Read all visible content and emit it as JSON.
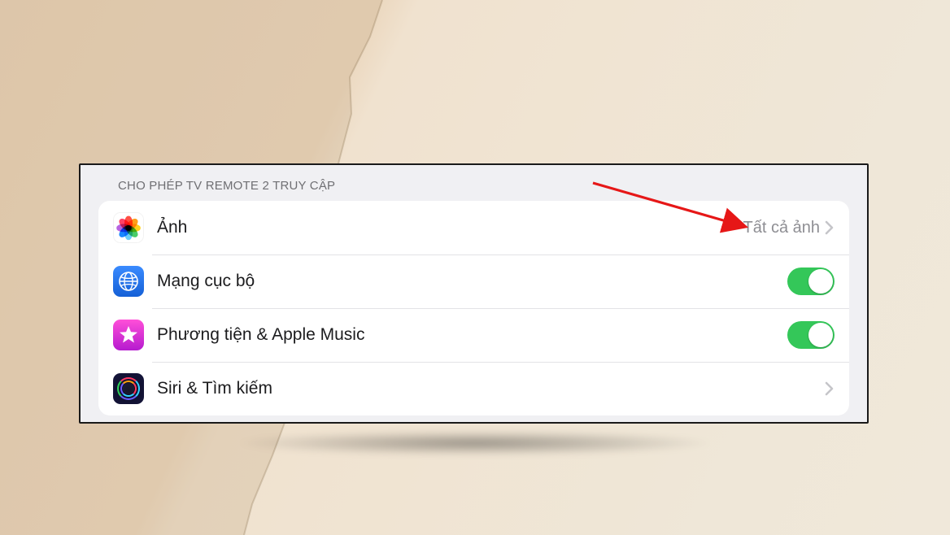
{
  "section_header": "CHO PHÉP TV REMOTE 2 TRUY CẬP",
  "rows": {
    "photos": {
      "label": "Ảnh",
      "value": "Tất cả ảnh"
    },
    "network": {
      "label": "Mạng cục bộ",
      "toggle": true
    },
    "media": {
      "label": "Phương tiện & Apple Music",
      "toggle": true
    },
    "siri": {
      "label": "Siri & Tìm kiếm"
    }
  },
  "annotation": {
    "arrow_color": "#e61717"
  },
  "icons": {
    "photos_petals": [
      {
        "color": "#ff3b30"
      },
      {
        "color": "#ff9500"
      },
      {
        "color": "#ffcc00"
      },
      {
        "color": "#34c759"
      },
      {
        "color": "#5ac8fa"
      },
      {
        "color": "#007aff"
      },
      {
        "color": "#af52de"
      },
      {
        "color": "#ff2d55"
      }
    ]
  }
}
